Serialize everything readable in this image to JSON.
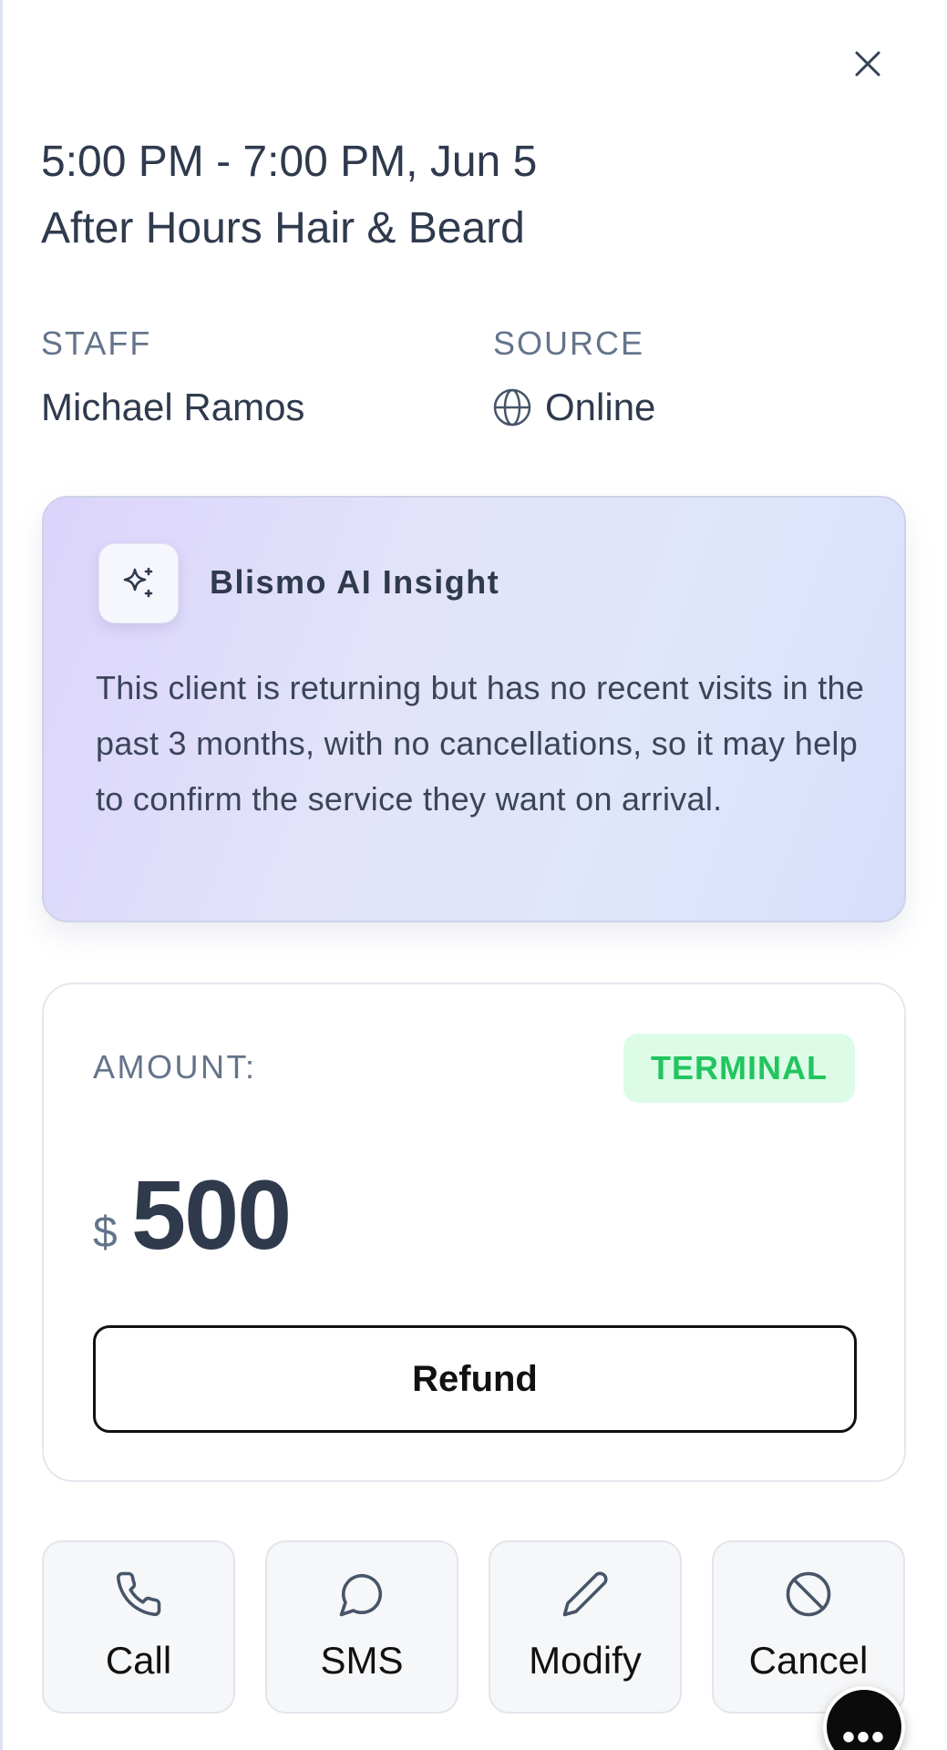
{
  "header": {
    "close_icon": "close-icon",
    "time_range": "5:00 PM - 7:00 PM, Jun 5",
    "service": "After Hours Hair & Beard"
  },
  "meta": {
    "staff_label": "STAFF",
    "staff_value": "Michael Ramos",
    "source_label": "SOURCE",
    "source_icon": "globe-icon",
    "source_value": "Online"
  },
  "insight": {
    "icon": "sparkle-icon",
    "title": "Blismo AI Insight",
    "text": "This client is returning but has no recent visits in the past 3 months, with no cancellations, so it may help to confirm the service they want on arrival."
  },
  "payment": {
    "amount_label": "AMOUNT:",
    "badge": "TERMINAL",
    "badge_colors": {
      "background": "#dcfce7",
      "text": "#22c55e"
    },
    "currency_symbol": "$",
    "amount": "500",
    "refund_label": "Refund"
  },
  "actions": [
    {
      "label": "Call",
      "icon": "phone-icon"
    },
    {
      "label": "SMS",
      "icon": "chat-bubble-icon"
    },
    {
      "label": "Modify",
      "icon": "pencil-icon"
    },
    {
      "label": "Cancel",
      "icon": "ban-icon"
    }
  ],
  "fab": {
    "glyph": "•••",
    "icon": "more-icon"
  }
}
